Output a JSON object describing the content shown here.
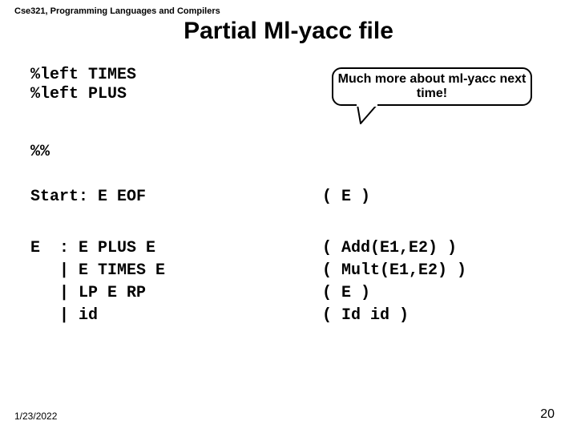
{
  "course": "Cse321, Programming Languages and Compilers",
  "title": "Partial Ml-yacc file",
  "callout": "Much more about ml-yacc next time!",
  "prec": "%left TIMES\n%left PLUS",
  "sep": "%%",
  "start_left": "Start: E EOF",
  "start_right": "( E )",
  "e_left": "E  : E PLUS E\n   | E TIMES E\n   | LP E RP\n   | id",
  "e_right": "( Add(E1,E2) )\n( Mult(E1,E2) )\n( E )\n( Id id )",
  "date": "1/23/2022",
  "page": "20"
}
